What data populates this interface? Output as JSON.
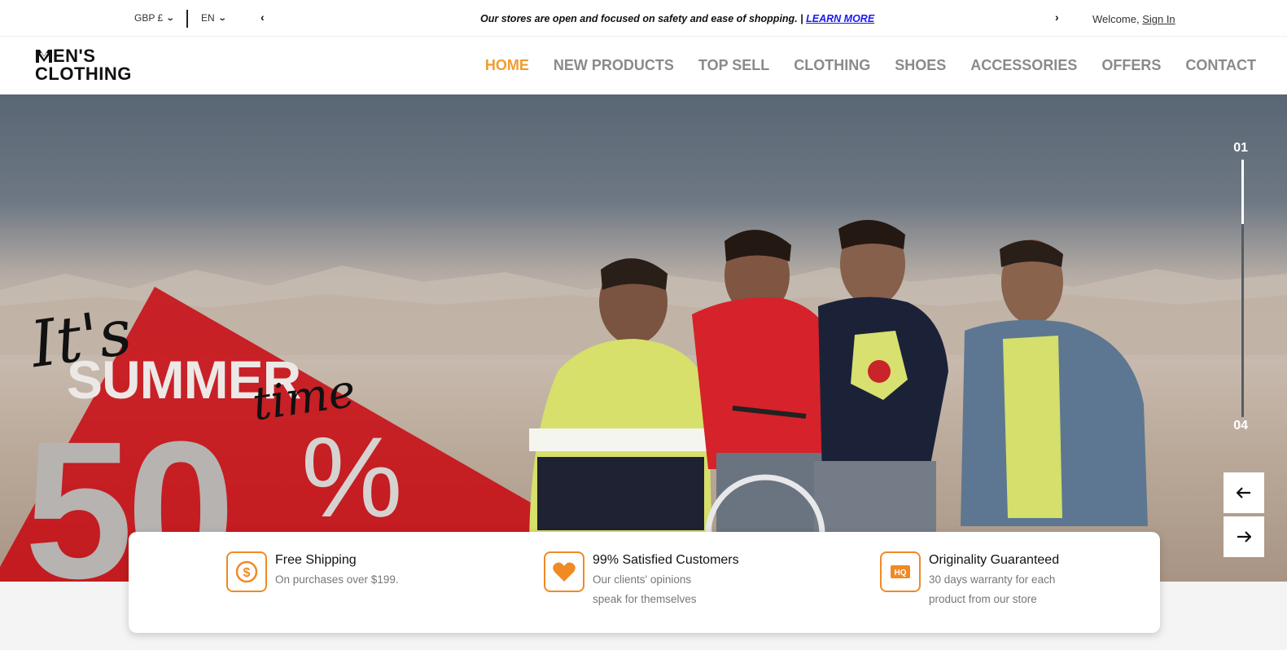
{
  "topbar": {
    "currency": "GBP £",
    "language": "EN",
    "announcement": "Our stores are open and focused on safety and ease of shopping. |",
    "announcement_link": "LEARN MORE",
    "welcome": "Welcome,",
    "sign_in": "Sign In"
  },
  "logo": {
    "line1": "EN'S",
    "line2": "CLOTHING"
  },
  "nav": {
    "items": [
      "HOME",
      "NEW PRODUCTS",
      "TOP SELL",
      "CLOTHING",
      "SHOES",
      "ACCESSORIES",
      "OFFERS",
      "CONTACT"
    ],
    "active": "HOME"
  },
  "hero": {
    "its": "It's",
    "summer": "SUMMER",
    "time": "time",
    "fifty": "50",
    "percent": "%",
    "slide_current": "01",
    "slide_total": "04",
    "prev_icon": "arrow-left-icon",
    "next_icon": "arrow-right-icon",
    "slide_progress": 0.25
  },
  "features": [
    {
      "icon": "dollar-icon",
      "title": "Free Shipping",
      "desc": [
        "On purchases over $199."
      ]
    },
    {
      "icon": "heart-icon",
      "title": "99% Satisfied Customers",
      "desc": [
        "Our clients' opinions",
        "speak for themselves"
      ]
    },
    {
      "icon": "hq-icon",
      "title": "Originality Guaranteed",
      "desc": [
        "30 days warranty for each",
        "product from our store"
      ]
    }
  ],
  "colors": {
    "accent": "#f29b30",
    "icon_orange": "#f08a24",
    "promo_red": "#c8000a"
  }
}
